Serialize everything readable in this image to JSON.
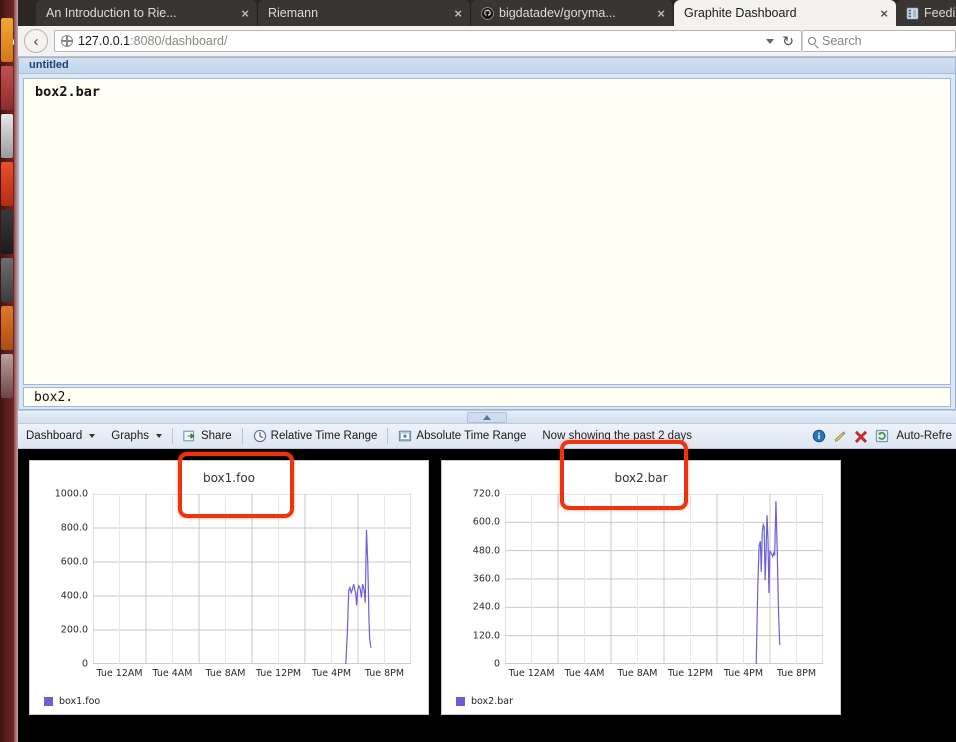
{
  "browser": {
    "tabs": [
      {
        "title": "An Introduction to Rie...",
        "favicon": "none",
        "active": false,
        "close_label": "×"
      },
      {
        "title": "Riemann",
        "favicon": "none",
        "active": false,
        "close_label": "×"
      },
      {
        "title": "bigdatadev/goryma...",
        "favicon": "github-icon",
        "active": false,
        "close_label": "×"
      },
      {
        "title": "Graphite Dashboard",
        "favicon": "none",
        "active": true,
        "close_label": "×"
      },
      {
        "title": "Feeding",
        "favicon": "grid-icon",
        "active": false,
        "close_label": ""
      }
    ],
    "back_button": "‹",
    "url_host": "127.0.0.1",
    "url_rest": ":8080/dashboard/",
    "url_full": "127.0.0.1:8080/dashboard/",
    "reload_glyph": "↻",
    "search_placeholder": "Search"
  },
  "composer": {
    "title": "untitled",
    "suggestions": [
      "box2.bar"
    ],
    "query_value": "box2."
  },
  "toolbar": {
    "menus": [
      {
        "label": "Dashboard",
        "has_caret": true
      },
      {
        "label": "Graphs",
        "has_caret": true
      }
    ],
    "actions": [
      {
        "label": "Share",
        "icon": "share-icon"
      },
      {
        "label": "Relative Time Range",
        "icon": "clock-icon"
      },
      {
        "label": "Absolute Time Range",
        "icon": "calendar-icon"
      }
    ],
    "status": "Now showing the past 2 days",
    "right_icons": [
      {
        "name": "info-icon",
        "color": "#1f6fbf"
      },
      {
        "name": "edit-icon",
        "color": "#d8c24a"
      },
      {
        "name": "delete-icon",
        "color": "#dd2222"
      },
      {
        "name": "refresh-icon",
        "color": "#3f9f3f"
      }
    ],
    "auto_refresh_label": "Auto-Refre"
  },
  "chart_data": [
    {
      "type": "line",
      "title": "box1.foo",
      "xlabel": "",
      "ylabel": "",
      "ylim": [
        0,
        1000
      ],
      "yticks": [
        "0",
        "200.0",
        "400.0",
        "600.0",
        "800.0",
        "1000.0"
      ],
      "ytick_values": [
        0,
        200,
        400,
        600,
        800,
        1000
      ],
      "xticks": [
        "Tue 12AM",
        "Tue  4AM",
        "Tue  8AM",
        "Tue 12PM",
        "Tue  4PM",
        "Tue  8PM"
      ],
      "grid": true,
      "legend": [
        "box1.foo"
      ],
      "legend_position": "bottom-left",
      "series": [
        {
          "name": "box1.foo",
          "color": "#6b5fd6",
          "x": [
            0.795,
            0.8,
            0.804,
            0.808,
            0.812,
            0.816,
            0.82,
            0.823,
            0.826,
            0.829,
            0.832,
            0.836,
            0.84,
            0.844,
            0.848,
            0.852,
            0.856,
            0.86,
            0.864,
            0.866,
            0.868,
            0.87,
            0.874
          ],
          "values": [
            0,
            190,
            430,
            450,
            420,
            440,
            470,
            440,
            415,
            345,
            430,
            460,
            445,
            390,
            470,
            440,
            360,
            790,
            600,
            430,
            250,
            150,
            95
          ]
        }
      ]
    },
    {
      "type": "line",
      "title": "box2.bar",
      "xlabel": "",
      "ylabel": "",
      "ylim": [
        0,
        720
      ],
      "yticks": [
        "0",
        "120.0",
        "240.0",
        "360.0",
        "480.0",
        "600.0",
        "720.0"
      ],
      "ytick_values": [
        0,
        120,
        240,
        360,
        480,
        600,
        720
      ],
      "xticks": [
        "Tue 12AM",
        "Tue  4AM",
        "Tue  8AM",
        "Tue 12PM",
        "Tue  4PM",
        "Tue  8PM"
      ],
      "grid": true,
      "legend": [
        "box2.bar"
      ],
      "legend_position": "bottom-left",
      "series": [
        {
          "name": "box2.bar",
          "color": "#6b5fd6",
          "x": [
            0.79,
            0.795,
            0.799,
            0.803,
            0.806,
            0.809,
            0.812,
            0.815,
            0.818,
            0.821,
            0.824,
            0.827,
            0.83,
            0.833,
            0.836,
            0.839,
            0.842,
            0.845,
            0.848,
            0.852,
            0.856,
            0.86,
            0.864
          ],
          "values": [
            0,
            330,
            500,
            520,
            390,
            560,
            590,
            580,
            355,
            470,
            630,
            530,
            300,
            480,
            470,
            465,
            455,
            470,
            460,
            690,
            480,
            230,
            80
          ]
        }
      ]
    }
  ]
}
